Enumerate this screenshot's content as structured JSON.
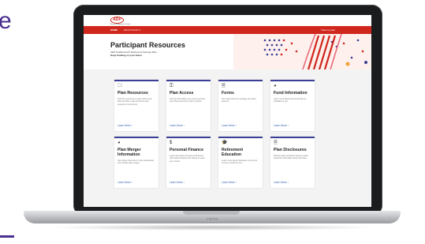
{
  "window": {
    "device_label": "Laptop",
    "edge_letter": "e"
  },
  "header": {
    "logo_text": "ADP",
    "logo_subtext": "Always Designing for People",
    "nav": {
      "home": "HOME",
      "resources": "RESOURCES ▾",
      "view_plan": "View my plan"
    }
  },
  "hero": {
    "title": "Participant Resources",
    "subtitle": "ADP TotalSource® Retirement Savings Plan",
    "tagline": "Keep thinking of your future"
  },
  "colors": {
    "brand_red": "#d0271d",
    "card_accent": "#3b3f95",
    "link_blue": "#3b63b8"
  },
  "cards": [
    {
      "icon": "folder-icon",
      "glyph": "🗀",
      "title": "Plan Resources",
      "text": "Find the resources to learn about your Plan benefits, make decisions and prepare for retirement.",
      "link": "Learn More ›"
    },
    {
      "icon": "key-icon",
      "glyph": "⚿",
      "title": "Plan Access",
      "text": "Get the information you need to access your Plan account by web or phone.",
      "link": "Learn More ›"
    },
    {
      "icon": "document-icon",
      "glyph": "🗎",
      "title": "Forms",
      "text": "Use these forms to manage your Plan account.",
      "link": "Learn More ›"
    },
    {
      "icon": "pie-chart-icon",
      "glyph": "◕",
      "title": "Fund Information",
      "text": "Learn more about the funds that are available to you.",
      "link": "Learn More ›"
    },
    {
      "icon": "merge-icon",
      "glyph": "◕",
      "title": "Plan Merger Information",
      "text": "Use these resources to help understand your 401(k) plan merger.",
      "link": "Learn More ›"
    },
    {
      "icon": "dollar-icon",
      "glyph": "$",
      "title": "Personal Finance",
      "text": "Learn the basics of personal finances with helpful articles and videos to meet your needs.",
      "link": "Learn More ›"
    },
    {
      "icon": "graduation-cap-icon",
      "glyph": "🎓",
      "title": "Retirement Education",
      "text": "Learn more about strategies to put your money to work for you.",
      "link": "Learn More ›"
    },
    {
      "icon": "disclosure-document-icon",
      "glyph": "🗎",
      "title": "Plan Disclosures",
      "text": "Review these required notices to learn important information about the Plan.",
      "link": "Learn More ›"
    }
  ]
}
